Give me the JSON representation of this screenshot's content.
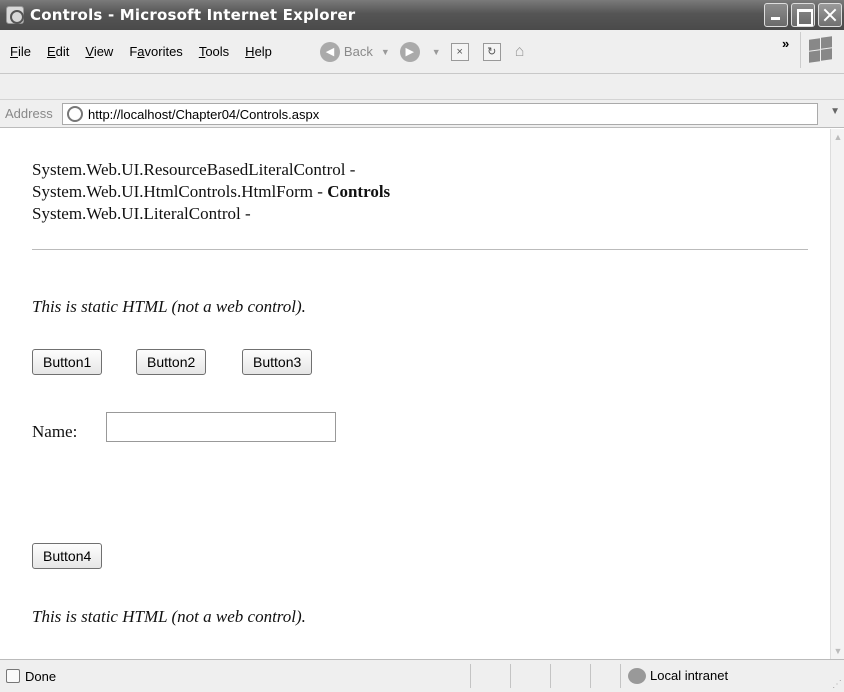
{
  "window": {
    "title": "Controls - Microsoft Internet Explorer"
  },
  "menubar": {
    "items": [
      {
        "accel": "F",
        "rest": "ile"
      },
      {
        "accel": "E",
        "rest": "dit"
      },
      {
        "accel": "V",
        "rest": "iew"
      },
      {
        "pre": "F",
        "accel": "a",
        "rest": "vorites"
      },
      {
        "accel": "T",
        "rest": "ools"
      },
      {
        "accel": "H",
        "rest": "elp"
      }
    ]
  },
  "toolbar": {
    "back_label": "Back"
  },
  "address": {
    "label": "Address",
    "url": "http://localhost/Chapter04/Controls.aspx"
  },
  "content": {
    "control_tree": [
      {
        "text": "System.Web.UI.ResourceBasedLiteralControl -",
        "suffix": ""
      },
      {
        "text": "System.Web.UI.HtmlControls.HtmlForm - ",
        "suffix": "Controls"
      },
      {
        "text": "System.Web.UI.LiteralControl -",
        "suffix": ""
      }
    ],
    "static_text_1": "This is static HTML (not a web control).",
    "buttons": [
      "Button1",
      "Button2",
      "Button3"
    ],
    "name_label": "Name:",
    "name_value": "",
    "button4": "Button4",
    "static_text_2": "This is static HTML (not a web control)."
  },
  "status": {
    "left": "Done",
    "zone": "Local intranet"
  }
}
